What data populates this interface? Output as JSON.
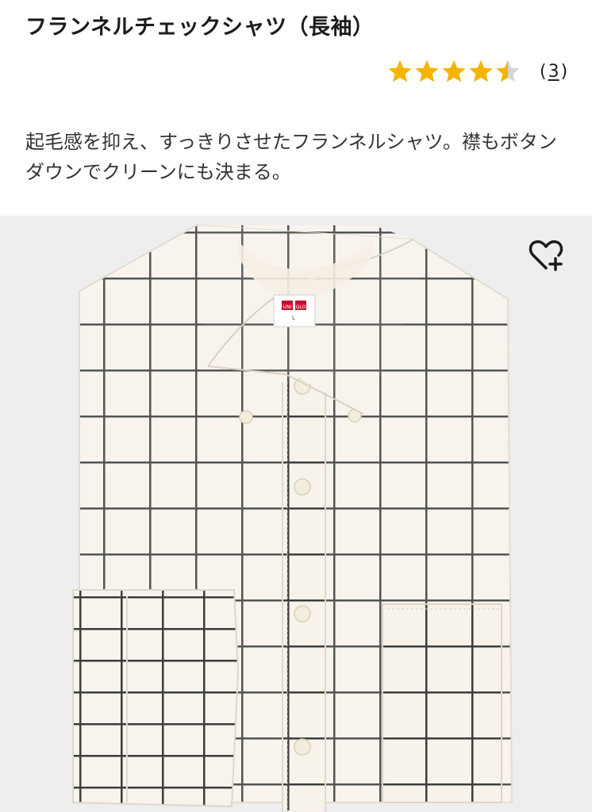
{
  "product": {
    "title": "フランネルチェックシャツ（長袖）",
    "rating": {
      "value": 4.5,
      "max": 5,
      "review_open": "(",
      "review_count": "3",
      "review_close": ")",
      "star_color": "#f5b400",
      "empty_color": "#d5d5d5"
    },
    "description": "起毛感を抑え、すっきりさせたフランネルシャツ。襟もボタンダウンでクリーンにも決まる。",
    "image": {
      "background": "#eeeeef",
      "fabric_color": "#f7f2ea",
      "check_color": "#3a3d3c",
      "label_brand": "UNI QLO",
      "label_size": "L"
    },
    "favorite_icon": "heart-plus-icon"
  }
}
